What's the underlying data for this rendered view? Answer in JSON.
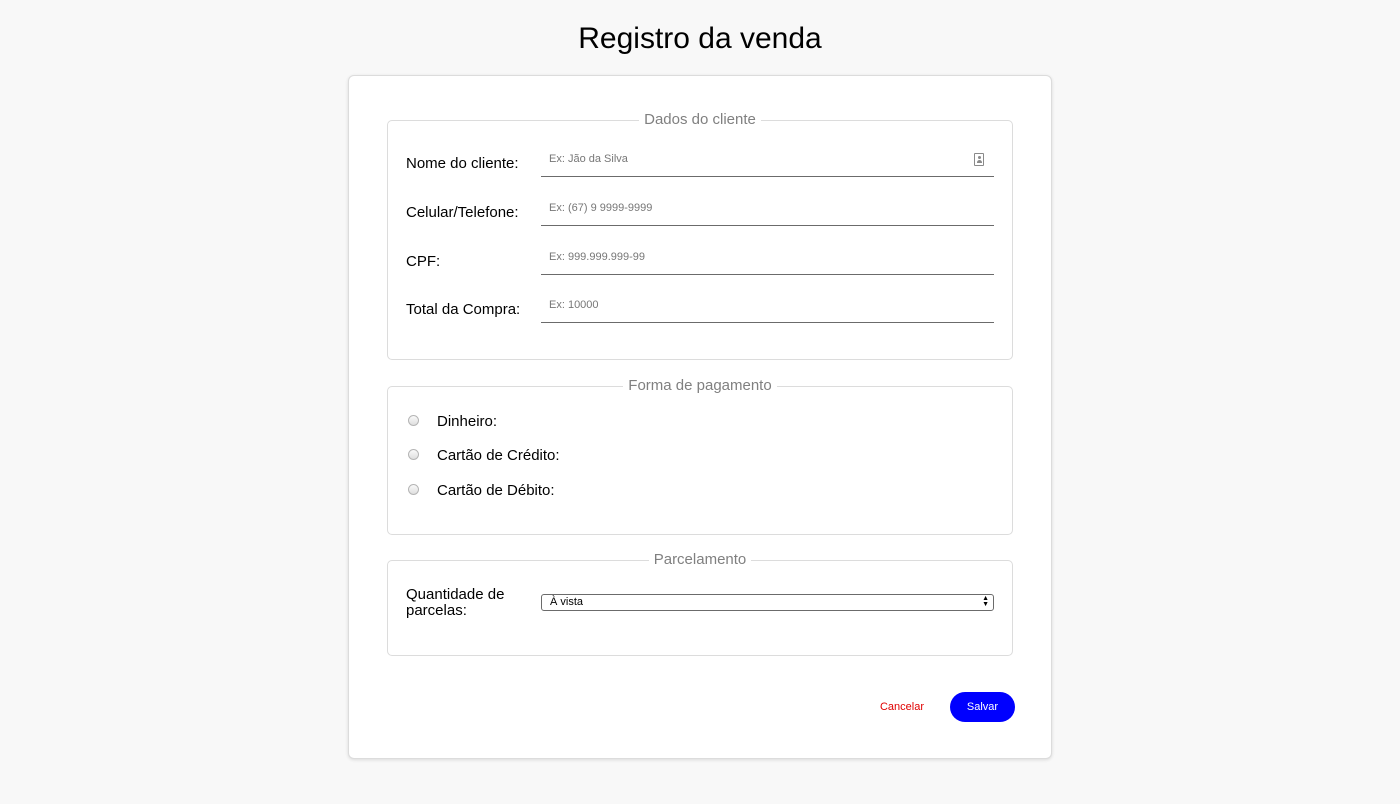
{
  "page": {
    "title": "Registro da venda"
  },
  "cliente": {
    "legend": "Dados do cliente",
    "fields": [
      {
        "label": "Nome do cliente:",
        "placeholder": "Ex: Jão da Silva",
        "value": ""
      },
      {
        "label": "Celular/Telefone:",
        "placeholder": "Ex: (67) 9 9999-9999",
        "value": ""
      },
      {
        "label": "CPF:",
        "placeholder": "Ex: 999.999.999-99",
        "value": ""
      },
      {
        "label": "Total da Compra:",
        "placeholder": "Ex: 10000",
        "value": ""
      }
    ],
    "name_icon": "contact-card-icon"
  },
  "pagamento": {
    "legend": "Forma de pagamento",
    "options": [
      {
        "label": "Dinheiro:",
        "checked": false
      },
      {
        "label": "Cartão de Crédito:",
        "checked": false
      },
      {
        "label": "Cartão de Débito:",
        "checked": false
      }
    ]
  },
  "parcelamento": {
    "legend": "Parcelamento",
    "label": "Quantidade de parcelas:",
    "selected": "À vista",
    "arrows": "▲▼"
  },
  "actions": {
    "cancel_label": "Cancelar",
    "save_label": "Salvar"
  },
  "colors": {
    "background": "#f8f8f8",
    "save_button": "#0000ff",
    "cancel_text": "#e00000",
    "legend_text": "#808080"
  }
}
